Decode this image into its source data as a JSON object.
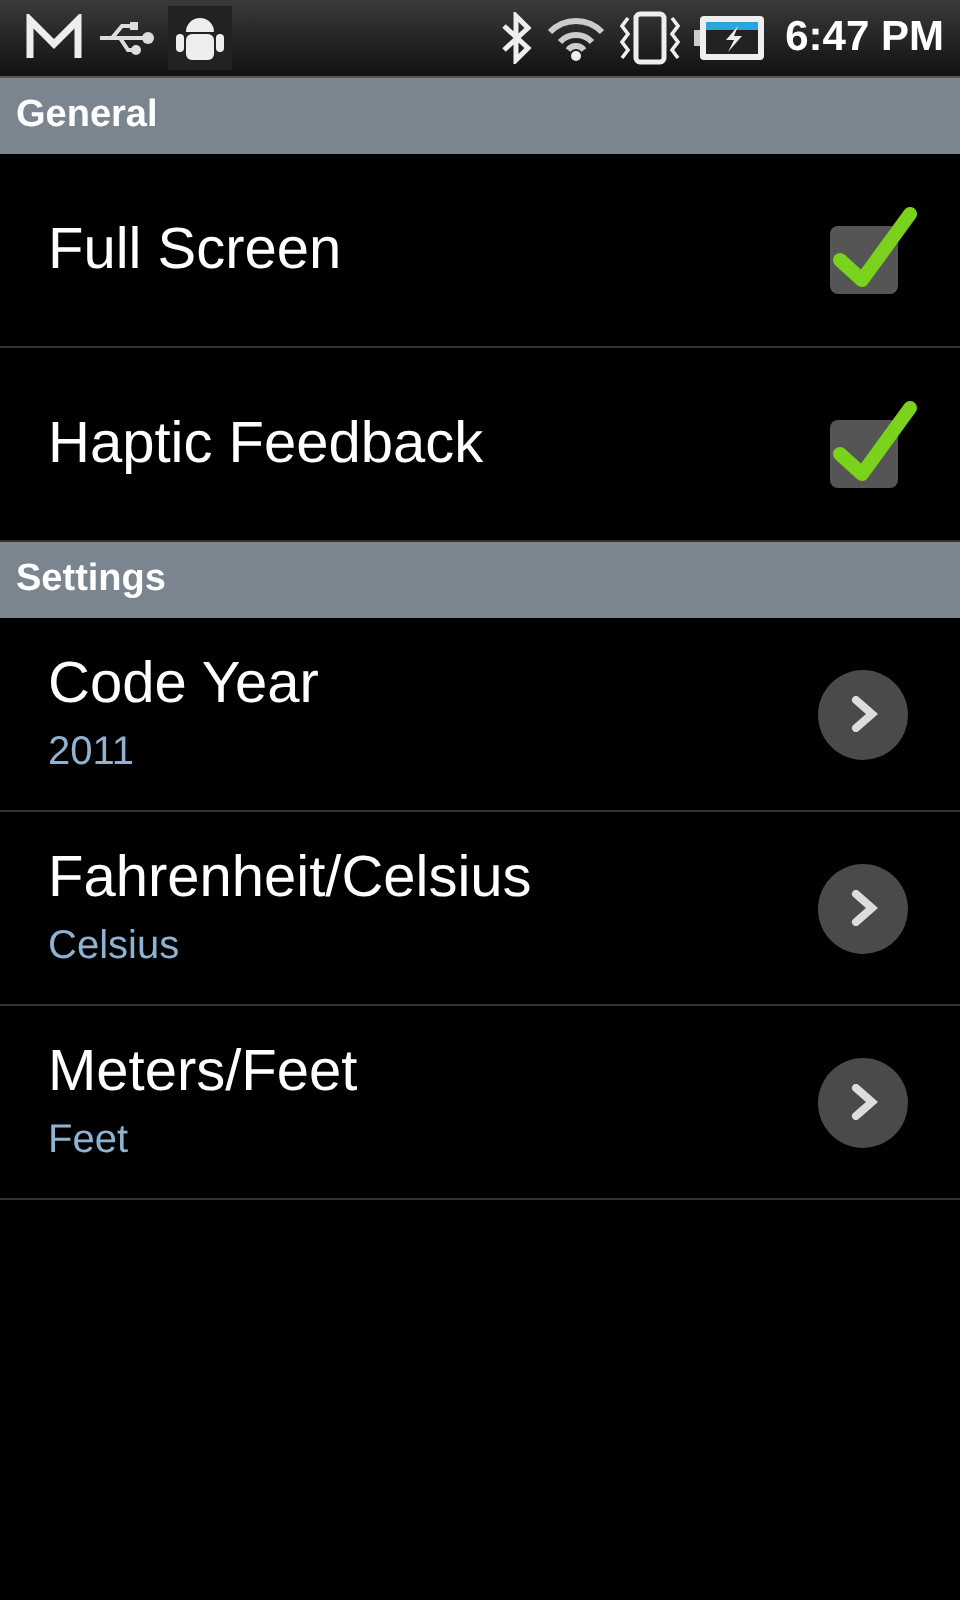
{
  "status_bar": {
    "time": "6:47 PM"
  },
  "sections": [
    {
      "title": "General",
      "items": [
        {
          "kind": "checkbox",
          "title": "Full Screen",
          "checked": true
        },
        {
          "kind": "checkbox",
          "title": "Haptic Feedback",
          "checked": true
        }
      ]
    },
    {
      "title": "Settings",
      "items": [
        {
          "kind": "list",
          "title": "Code Year",
          "summary": "2011"
        },
        {
          "kind": "list",
          "title": "Fahrenheit/Celsius",
          "summary": "Celsius"
        },
        {
          "kind": "list",
          "title": "Meters/Feet",
          "summary": "Feet"
        }
      ]
    }
  ]
}
